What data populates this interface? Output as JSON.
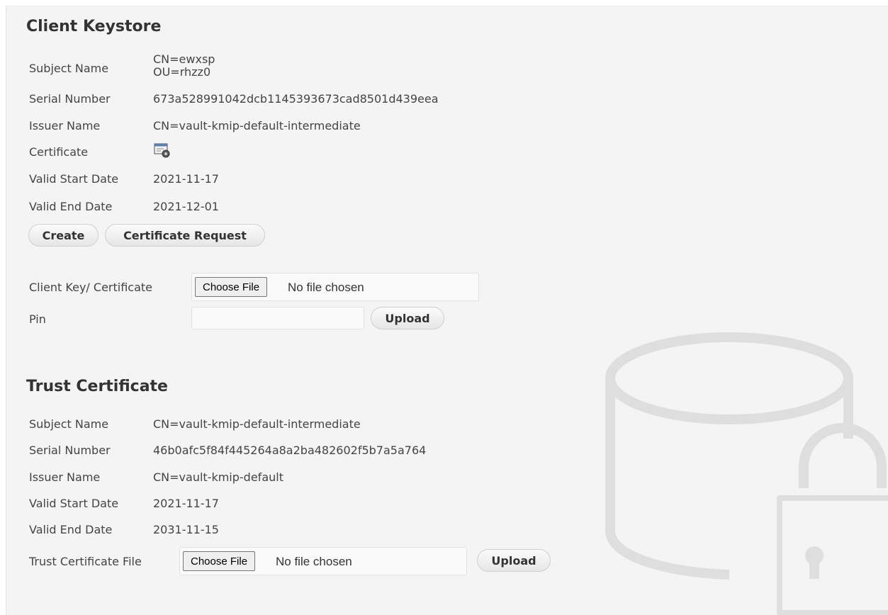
{
  "client_keystore": {
    "title": "Client Keystore",
    "subject_name_label": "Subject Name",
    "subject_name_line1": "CN=ewxsp",
    "subject_name_line2": "OU=rhzz0",
    "serial_number_label": "Serial Number",
    "serial_number": "673a528991042dcb1145393673cad8501d439eea",
    "issuer_name_label": "Issuer Name",
    "issuer_name": "CN=vault-kmip-default-intermediate",
    "certificate_label": "Certificate",
    "certificate_icon": "certificate-icon",
    "valid_start_label": "Valid Start Date",
    "valid_start": "2021-11-17",
    "valid_end_label": "Valid End Date",
    "valid_end": "2021-12-01",
    "create_button": "Create",
    "certificate_request_button": "Certificate Request",
    "client_key_label": "Client Key/ Certificate",
    "choose_file_button": "Choose File",
    "file_status": "No file chosen",
    "pin_label": "Pin",
    "pin_value": "",
    "upload_button": "Upload"
  },
  "trust_certificate": {
    "title": "Trust Certificate",
    "subject_name_label": "Subject Name",
    "subject_name": "CN=vault-kmip-default-intermediate",
    "serial_number_label": "Serial Number",
    "serial_number": "46b0afc5f84f445264a8a2ba482602f5b7a5a764",
    "issuer_name_label": "Issuer Name",
    "issuer_name": "CN=vault-kmip-default",
    "valid_start_label": "Valid Start Date",
    "valid_start": "2021-11-17",
    "valid_end_label": "Valid End Date",
    "valid_end": "2031-11-15",
    "file_label": "Trust Certificate File",
    "choose_file_button": "Choose File",
    "file_status": "No file chosen",
    "upload_button": "Upload"
  },
  "watermark_icon": "database-lock-icon",
  "colors": {
    "panel_background": "#f4f4f4",
    "watermark": "#dedede",
    "text": "#444444"
  }
}
